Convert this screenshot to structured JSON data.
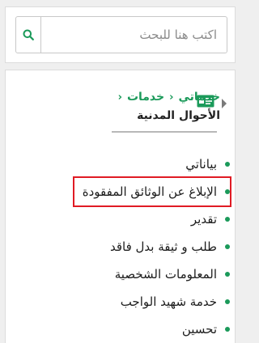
{
  "search": {
    "placeholder": "اكتب هنا للبحث",
    "button_icon": "search-icon"
  },
  "breadcrumb": {
    "items": [
      "خدماتي",
      "خدمات"
    ],
    "separator": "‹",
    "icon": "id-card-icon"
  },
  "page_title": "الأحوال المدنية",
  "menu": {
    "items": [
      "بياناتي",
      "الإبلاغ عن الوثائق المفقودة",
      "تقدير",
      "طلب و ثيقة بدل فاقد",
      "المعلومات الشخصية",
      "خدمة شهيد الواجب",
      "تحسين"
    ],
    "highlighted_index": 1
  },
  "colors": {
    "accent": "#1b9a5a",
    "highlight_border": "#e01b24",
    "background": "#efefef"
  }
}
